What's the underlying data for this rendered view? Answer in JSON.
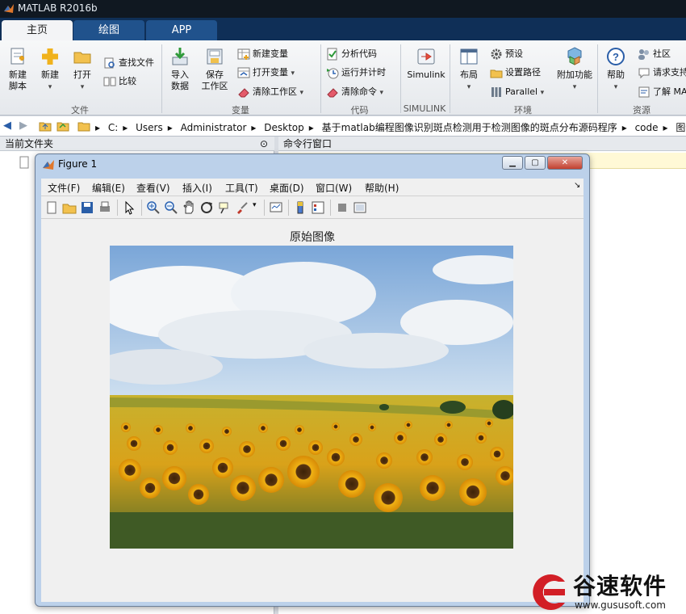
{
  "app": {
    "title": "MATLAB R2016b"
  },
  "tabs": [
    {
      "label": "主页",
      "active": true
    },
    {
      "label": "绘图",
      "active": false
    },
    {
      "label": "APP",
      "active": false
    }
  ],
  "ribbon": {
    "file": {
      "label": "文件",
      "new_script": "新建\n脚本",
      "new": "新建",
      "open": "打开",
      "find_files": "查找文件",
      "compare": "比较"
    },
    "variable": {
      "label": "变量",
      "import": "导入\n数据",
      "save_ws": "保存\n工作区",
      "new_var": "新建变量",
      "open_var": "打开变量",
      "clear_ws": "清除工作区"
    },
    "code": {
      "label": "代码",
      "analyze": "分析代码",
      "run_time": "运行并计时",
      "clear_cmd": "清除命令"
    },
    "simulink": {
      "label": "SIMULINK",
      "btn": "Simulink"
    },
    "env": {
      "label": "环境",
      "layout": "布局",
      "prefs": "预设",
      "set_path": "设置路径",
      "parallel": "Parallel",
      "addons": "附加功能"
    },
    "resources": {
      "label": "资源",
      "help": "帮助",
      "community": "社区",
      "support": "请求支持",
      "learn": "了解 MA"
    }
  },
  "address": {
    "path": [
      "C:",
      "Users",
      "Administrator",
      "Desktop",
      "基于matlab编程图像识别斑点检测用于检测图像的斑点分布源码程序",
      "code",
      "图像"
    ]
  },
  "panels": {
    "current_folder": "当前文件夹",
    "command_window": "命令行窗口"
  },
  "figure": {
    "title": "Figure 1",
    "menu": [
      "文件(F)",
      "编辑(E)",
      "查看(V)",
      "插入(I)",
      "工具(T)",
      "桌面(D)",
      "窗口(W)",
      "帮助(H)"
    ],
    "axes_title": "原始图像",
    "image": "sunflower-field-photo"
  },
  "watermark": {
    "brand": "谷速软件",
    "url": "www.gususoft.com"
  },
  "colors": {
    "titlebar": "#101821",
    "tabs_bg": "#0f2f57",
    "tab_inactive": "#20528c",
    "ribbon": "#eceff2",
    "watermark_red": "#d21f26"
  }
}
